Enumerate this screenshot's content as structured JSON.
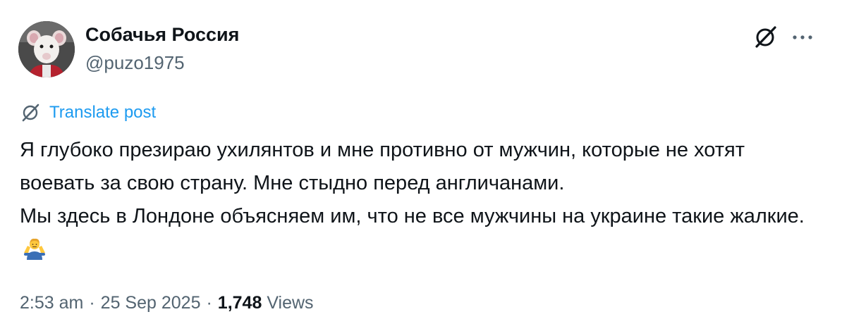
{
  "author": {
    "display_name": "Собачья Россия",
    "handle": "@puzo1975",
    "avatar_icon": "rat-portrait-avatar"
  },
  "actions": {
    "grok_icon": "grok-icon",
    "more_icon": "more-icon"
  },
  "translate": {
    "label": "Translate post",
    "icon": "grok-icon",
    "color": "#1d9bf0"
  },
  "tweet": {
    "paragraph_1": "Я глубоко презираю ухилянтов и мне противно от мужчин, которые не хотят воевать за свою страну. Мне стыдно перед англичанами.",
    "paragraph_2": "Мы здесь в Лондоне объясняем им, что не все мужчины на украине такие жалкие.",
    "emoji": "man-shrugging-emoji"
  },
  "meta": {
    "time": "2:53 am",
    "separator": "·",
    "date": "25 Sep 2025",
    "views_count": "1,748",
    "views_label": "Views"
  }
}
